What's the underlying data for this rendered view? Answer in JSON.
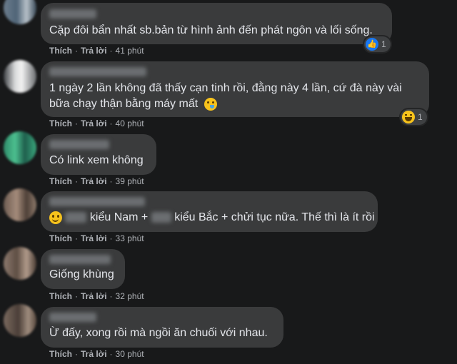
{
  "comments": [
    {
      "text": "Cặp đôi bẩn nhất sb.bản từ hình ảnh đến phát ngôn và lối sống.",
      "like_label": "Thích",
      "reply_label": "Trả lời",
      "time": "41 phút",
      "reaction": {
        "icon": "like-icon",
        "count": "1"
      }
    },
    {
      "text_line1": "1 ngày 2 lần không đã thấy cạn tinh rồi, đằng này 4 lần, cứ đà này vài",
      "text_line2": "bữa chạy thận bằng máy mất",
      "like_label": "Thích",
      "reply_label": "Trả lời",
      "time": "40 phút",
      "reaction": {
        "icon": "haha-icon",
        "count": "1"
      }
    },
    {
      "text": "Có link xem không",
      "like_label": "Thích",
      "reply_label": "Trả lời",
      "time": "39 phút"
    },
    {
      "text_part1": "kiểu Nam +",
      "text_part2": "kiểu Bắc + chửi tục nữa. Thế thì là ít rồi",
      "like_label": "Thích",
      "reply_label": "Trả lời",
      "time": "33 phút"
    },
    {
      "text": "Giống khùng",
      "like_label": "Thích",
      "reply_label": "Trả lời",
      "time": "32 phút"
    },
    {
      "text": "Ừ đấy, xong rồi mà ngồi ăn chuối với nhau.",
      "like_label": "Thích",
      "reply_label": "Trả lời",
      "time": "30 phút"
    }
  ],
  "colors": {
    "background": "#18191a",
    "bubble": "#3a3b3c",
    "text": "#e4e6eb",
    "meta": "#b0b3b8"
  }
}
